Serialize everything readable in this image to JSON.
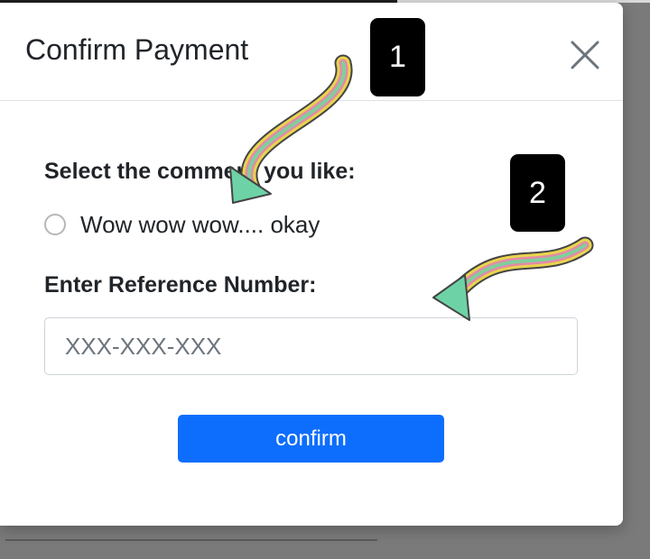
{
  "modal": {
    "title": "Confirm Payment",
    "close_icon": "close-icon",
    "comment_question": "Select the comment you like:",
    "comment_option": "Wow wow wow.... okay",
    "reference_label": "Enter Reference Number:",
    "reference_placeholder": "XXX-XXX-XXX",
    "reference_value": "",
    "confirm_label": "confirm"
  },
  "annotations": {
    "badge_1": "1",
    "badge_2": "2",
    "arrow_icon": "wavy-arrow-icon"
  },
  "colors": {
    "primary_button": "#0d6efd",
    "backdrop": "#7a7a7a",
    "arrow_head": "#6dd3a6",
    "arrow_stripes": [
      "#e8d44d",
      "#e48aa8",
      "#7fcf9c"
    ]
  }
}
